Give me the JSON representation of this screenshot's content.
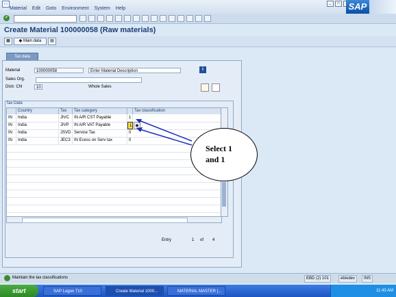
{
  "menu": {
    "items": [
      "Material",
      "Edit",
      "Goto",
      "Environment",
      "System",
      "Help"
    ]
  },
  "brand": {
    "logo": "SAP"
  },
  "page": {
    "title": "Create Material 100000058 (Raw materials)"
  },
  "appbar": {
    "main_data_label": "Main data"
  },
  "tab": {
    "label": "Tax data"
  },
  "form": {
    "material_label": "Material",
    "material_value": "100000058",
    "material_desc": "Enter Material Description",
    "sales_org_label": "Sales Org.",
    "sales_org_value": "",
    "distr_chl_label": "Distr. Chl",
    "distr_chl_value": "10",
    "distr_chl_desc": "Whole Sales"
  },
  "tax_table": {
    "group_title": "Tax Data",
    "headers": [
      "Country",
      "Tax",
      "Tax category",
      "Tax classification"
    ],
    "rows": [
      {
        "code": "IN",
        "country": "India",
        "tax": "JIVC",
        "category": "IN A/R CST Payable",
        "classification": "1"
      },
      {
        "code": "IN",
        "country": "India",
        "tax": "JIVP",
        "category": "IN A/R VAT Payable",
        "classification": "1"
      },
      {
        "code": "IN",
        "country": "India",
        "tax": "JSVD",
        "category": "Service Tax",
        "classification": "0"
      },
      {
        "code": "IN",
        "country": "India",
        "tax": "JEC3",
        "category": "IN Ecess on Serv tax",
        "classification": "0"
      }
    ],
    "entry_label": "Entry",
    "entry_current": "1",
    "entry_of": "of",
    "entry_total": "4"
  },
  "callout": {
    "line1": "Select 1",
    "line2": "and 1"
  },
  "status": {
    "message": "Maintain the tax classifications",
    "system": "EBD (2) 101",
    "server": "ebiodev",
    "mode": "INS"
  },
  "taskbar": {
    "start": "start",
    "tasks": [
      "SAP Logon 710",
      "Create Material 1000...",
      "MATERIAL MASTER [..."
    ],
    "time": "11:43 AM"
  },
  "colors": {
    "title": "#1c3d72",
    "window_bg": "#dbe8f6",
    "taskbar": "#2a62d0",
    "arrow": "#1a2fb8"
  }
}
